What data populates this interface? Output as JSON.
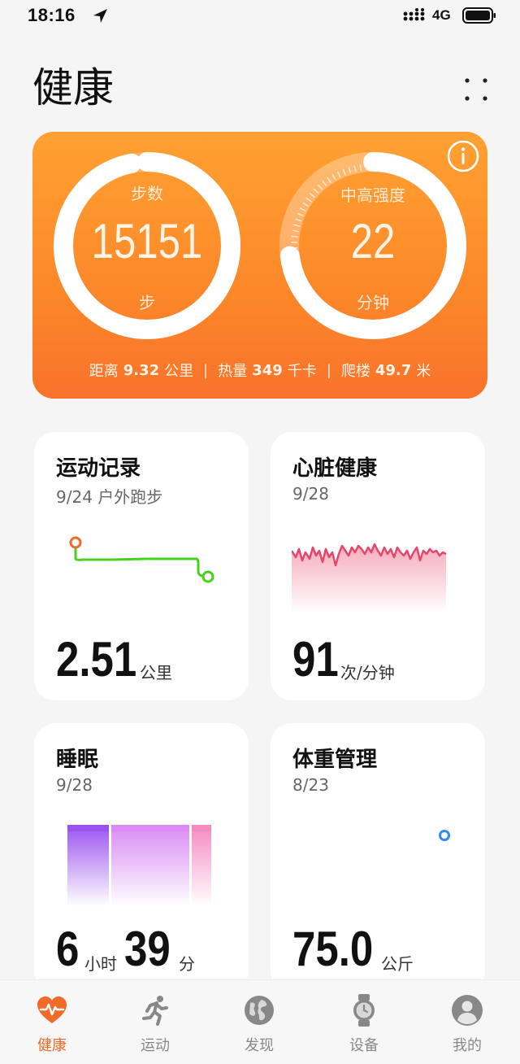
{
  "status_bar": {
    "time": "18:16",
    "network": "4G"
  },
  "header": {
    "title": "健康"
  },
  "activity": {
    "steps_label": "步数",
    "steps_value": "15151",
    "steps_unit": "步",
    "steps_progress": 0.97,
    "intensity_label": "中高强度",
    "intensity_value": "22",
    "intensity_unit": "分钟",
    "intensity_progress": 0.73,
    "distance_label": "距离",
    "distance_value": "9.32",
    "distance_unit": "公里",
    "calories_label": "热量",
    "calories_value": "349",
    "calories_unit": "千卡",
    "floors_label": "爬楼",
    "floors_value": "49.7",
    "floors_unit": "米",
    "separator": "|"
  },
  "tiles": {
    "exercise": {
      "title": "运动记录",
      "subtitle": "9/24 户外跑步",
      "value": "2.51",
      "unit": "公里"
    },
    "heart": {
      "title": "心脏健康",
      "subtitle": "9/28",
      "value": "91",
      "unit": "次/分钟"
    },
    "sleep": {
      "title": "睡眠",
      "subtitle": "9/28",
      "hours": "6",
      "hours_unit": "小时",
      "minutes": "39",
      "minutes_unit": "分"
    },
    "weight": {
      "title": "体重管理",
      "subtitle": "8/23",
      "value": "75.0",
      "unit": "公斤"
    }
  },
  "nav": {
    "items": [
      {
        "label": "健康",
        "icon": "heart-pulse-icon",
        "active": true
      },
      {
        "label": "运动",
        "icon": "running-icon",
        "active": false
      },
      {
        "label": "发现",
        "icon": "globe-icon",
        "active": false
      },
      {
        "label": "设备",
        "icon": "watch-icon",
        "active": false
      },
      {
        "label": "我的",
        "icon": "profile-icon",
        "active": false
      }
    ]
  },
  "colors": {
    "accent": "#f06a2a",
    "card_top": "#ffa132",
    "card_bottom": "#f9722b",
    "route": "#45d11c",
    "heart_line": "#e8456a",
    "sleep_deep": "#9b53f0",
    "sleep_light": "#d98af5",
    "sleep_awake": "#f58ac0",
    "weight_dot": "#2f8cf2"
  }
}
